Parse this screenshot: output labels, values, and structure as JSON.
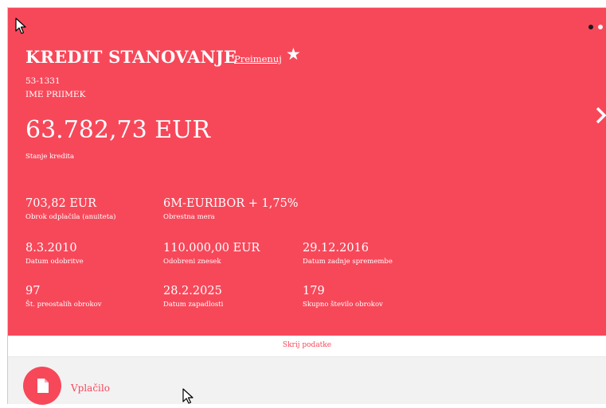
{
  "loan": {
    "title": "KREDIT STANOVANJE",
    "rename_link": "Preimenuj",
    "account_number": "53-1331",
    "owner": "IME  PRIIMEK",
    "balance": "63.782,73 EUR",
    "balance_label": "Stanje kredita"
  },
  "details": [
    {
      "value": "703,82 EUR",
      "label": "Obrok odplačila (anuiteta)"
    },
    {
      "value": "6M-EURIBOR + 1,75%",
      "label": "Obrestna mera"
    },
    {
      "value": "8.3.2010",
      "label": "Datum odobritve"
    },
    {
      "value": "110.000,00 EUR",
      "label": "Odobreni znesek"
    },
    {
      "value": "29.12.2016",
      "label": "Datum zadnje spremembe"
    },
    {
      "value": "97",
      "label": "Št. preostalih obrokov"
    },
    {
      "value": "28.2.2025",
      "label": "Datum zapadlosti"
    },
    {
      "value": "179",
      "label": "Skupno število obrokov"
    }
  ],
  "hide_details_link": "Skrij podatke",
  "actions": {
    "payment_label": "Vplačilo"
  },
  "carousel": {
    "total": 2,
    "active": 1
  },
  "icons": {
    "star": "star-icon",
    "next": "chevron-right-icon",
    "payment": "document-icon",
    "cursor": "mouse-pointer-icon"
  },
  "colors": {
    "card_bg": "#f7485a",
    "text_on_card": "#ffffff",
    "accent": "#f7485a",
    "bottom_bg": "#f2f2f2"
  }
}
